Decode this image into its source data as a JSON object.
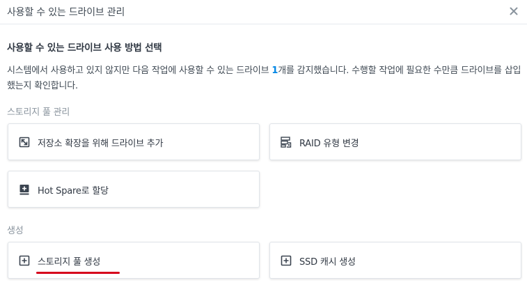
{
  "dialog": {
    "title": "사용할 수 있는 드라이브 관리",
    "close_label": "×"
  },
  "main": {
    "heading": "사용할 수 있는 드라이브 사용 방법 선택",
    "description_before": "시스템에서 사용하고 있지 않지만 다음 작업에 사용할 수 있는 드라이브 ",
    "drive_count": "1",
    "description_after": "개를 감지했습니다. 수행할 작업에 필요한 수만큼 드라이브를 삽입했는지 확인합니다.",
    "accent_color": "#0086e5"
  },
  "storage_pool_group": {
    "label": "스토리지 풀 관리",
    "cards": [
      {
        "label": "저장소 확장을 위해 드라이브 추가",
        "icon": "expand-icon"
      },
      {
        "label": "RAID 유형 변경",
        "icon": "raid-icon"
      },
      {
        "label": "Hot Spare로 할당",
        "icon": "hotspare-icon"
      }
    ]
  },
  "create_group": {
    "label": "생성",
    "cards": [
      {
        "label": "스토리지 풀 생성",
        "icon": "plus-box-icon",
        "highlighted": true,
        "highlight_color": "#d6001c"
      },
      {
        "label": "SSD 캐시 생성",
        "icon": "plus-box-icon"
      }
    ]
  }
}
